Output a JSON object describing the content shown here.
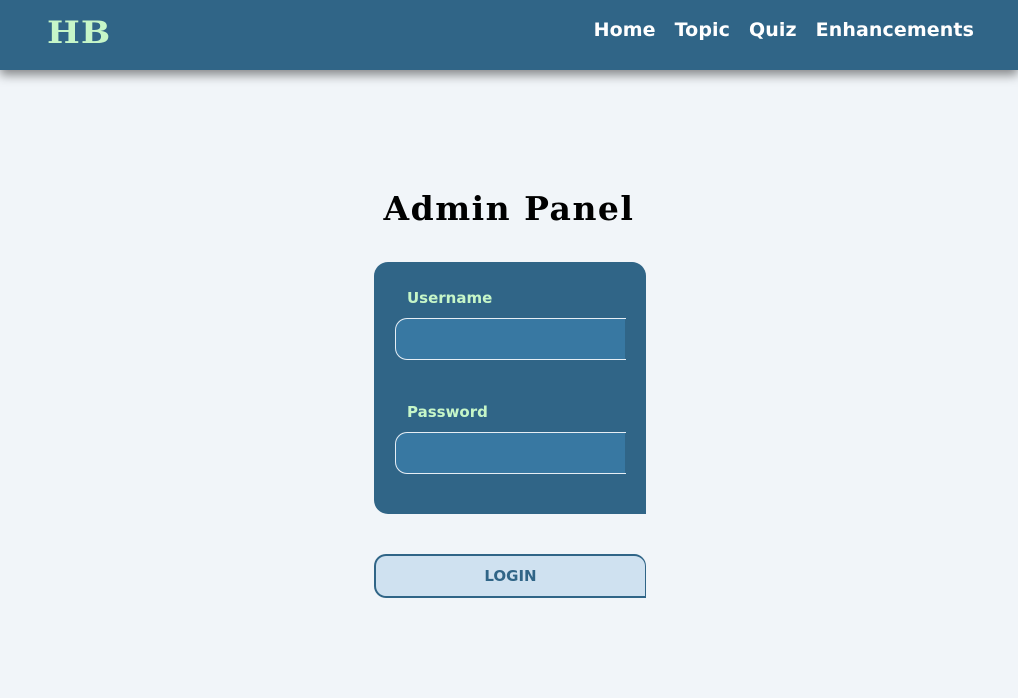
{
  "header": {
    "logo": "HB",
    "nav": [
      {
        "label": "Home"
      },
      {
        "label": "Topic"
      },
      {
        "label": "Quiz"
      },
      {
        "label": "Enhancements"
      }
    ]
  },
  "main": {
    "title": "Admin Panel",
    "form": {
      "username_label": "Username",
      "username_value": "",
      "password_label": "Password",
      "password_value": "",
      "login_label": "LOGIN"
    }
  },
  "colors": {
    "navbar_bg": "#306587",
    "logo_text": "#c6f6c8",
    "page_bg": "#f1f5f9",
    "card_bg": "#306587",
    "input_bg": "#3878a2",
    "label_text": "#c6f6c8",
    "button_bg": "#cfe1f0",
    "button_text": "#306587"
  }
}
